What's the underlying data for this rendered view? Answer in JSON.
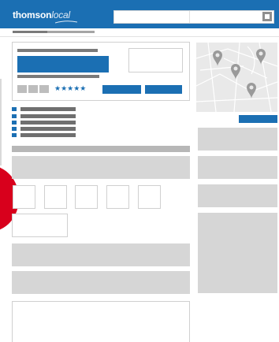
{
  "header": {
    "logo_thomson": "thomson",
    "logo_local": "local",
    "brand_color": "#1b6fb3"
  },
  "listing": {
    "stars": "★★★★★",
    "star_color": "#1b6fb3"
  },
  "icons": {
    "search": "search-icon",
    "map_pin": "map-pin-icon"
  },
  "colors": {
    "accent_red": "#d8001c",
    "placeholder_grey": "#d6d6d6"
  }
}
